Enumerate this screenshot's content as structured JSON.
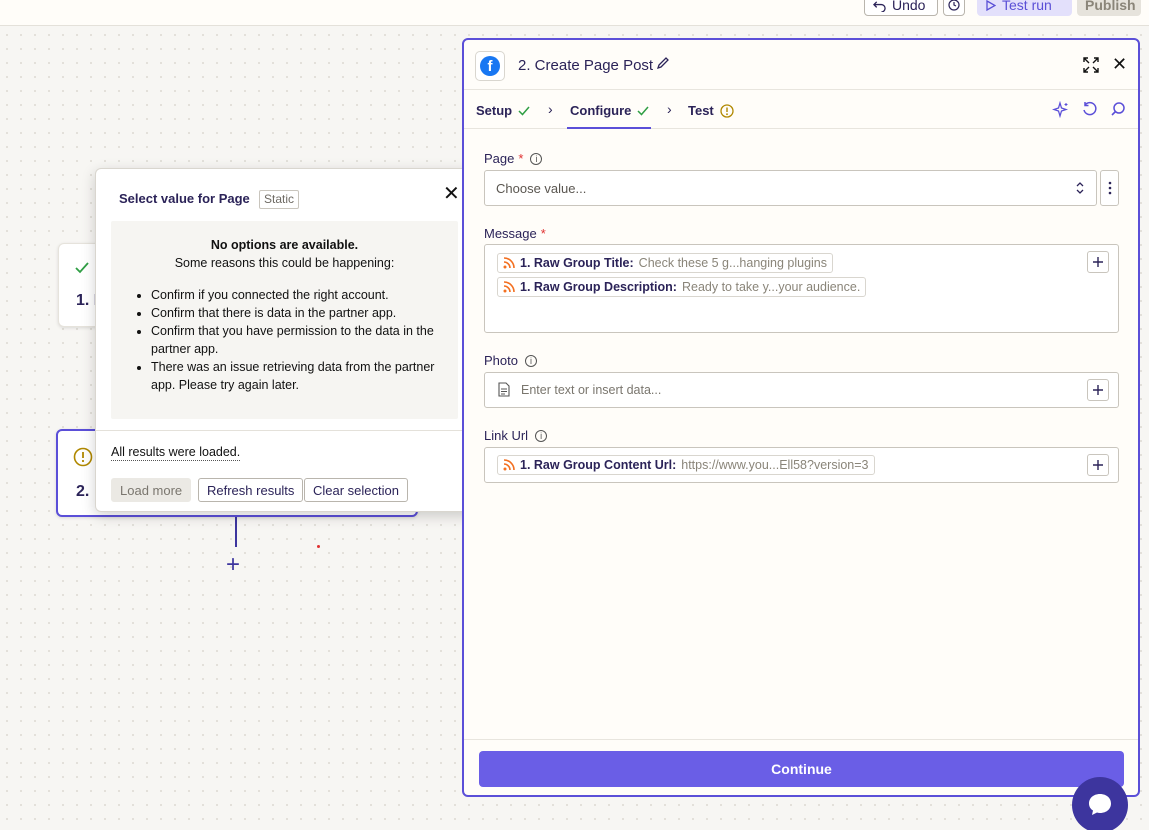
{
  "topbar": {
    "undo_label": "Undo",
    "test_run_label": "Test run",
    "publish_label": "Publish"
  },
  "canvas": {
    "node1_label": "1. I",
    "node2_label": "2.",
    "plus": "+"
  },
  "popover": {
    "title": "Select value for Page",
    "tag": "Static",
    "close": "✕",
    "heading": "No options are available.",
    "subheading": "Some reasons this could be happening:",
    "reasons": [
      "Confirm if you connected the right account.",
      "Confirm that there is data in the partner app.",
      "Confirm that you have permission to the data in the partner app.",
      "There was an issue retrieving data from the partner app. Please try again later."
    ],
    "loaded_text": "All results were loaded.",
    "load_more_label": "Load more",
    "refresh_label": "Refresh results",
    "clear_label": "Clear selection"
  },
  "panel": {
    "title": "2. Create Page Post",
    "fb_letter": "f",
    "close": "✕",
    "tabs": [
      {
        "label": "Setup"
      },
      {
        "label": "Configure"
      },
      {
        "label": "Test"
      }
    ],
    "fields": {
      "page": {
        "label": "Page",
        "required": "*",
        "placeholder": "Choose value..."
      },
      "message": {
        "label": "Message",
        "required": "*",
        "pills": [
          {
            "key": "1. Raw Group Title:",
            "value": "Check these 5 g...hanging plugins"
          },
          {
            "key": "1. Raw Group Description:",
            "value": "Ready to take y...your audience."
          }
        ]
      },
      "photo": {
        "label": "Photo",
        "placeholder": "Enter text or insert data..."
      },
      "link_url": {
        "label": "Link Url",
        "pill": {
          "key": "1. Raw Group Content Url:",
          "value": "https://www.you...Ell58?version=3"
        }
      }
    },
    "continue_label": "Continue"
  },
  "colors": {
    "accent": "#5b4fd8",
    "continue": "#6a5ee6",
    "required": "#e03131",
    "success": "#2f9e44",
    "warning": "#b08800"
  },
  "icons": [
    "undo-icon",
    "history-icon",
    "play-icon",
    "facebook-icon",
    "pencil-icon",
    "expand-icon",
    "close-icon",
    "check-icon",
    "chevron-right-icon",
    "warning-icon",
    "sparkle-icon",
    "refresh-icon",
    "search-icon",
    "info-icon",
    "updown-icon",
    "kebab-icon",
    "rss-icon",
    "document-icon",
    "plus-icon",
    "chat-icon"
  ]
}
